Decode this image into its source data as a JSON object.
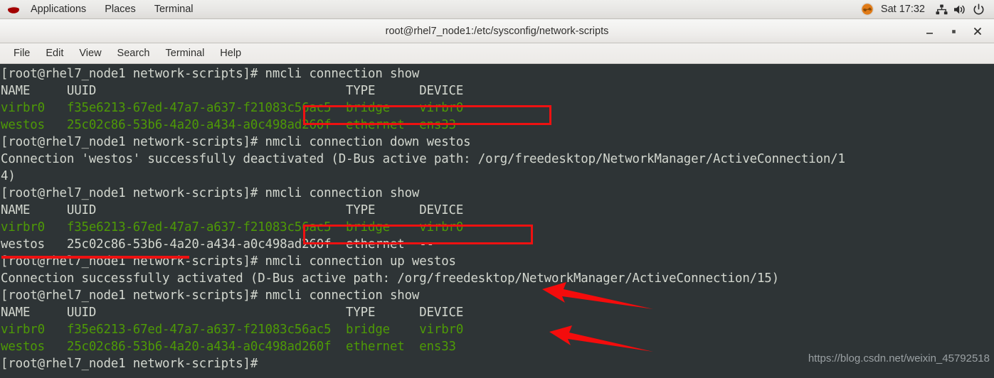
{
  "panel": {
    "logo_icon": "redhat-logo-icon",
    "menus": [
      {
        "label": "Applications",
        "name": "panel-menu-applications"
      },
      {
        "label": "Places",
        "name": "panel-menu-places"
      },
      {
        "label": "Terminal",
        "name": "panel-menu-terminal"
      }
    ],
    "tray": {
      "app_indicator_icon": "terminal-app-indicator-icon",
      "clock": "Sat 17:32",
      "network_icon": "network-icon",
      "volume_icon": "volume-icon",
      "power_icon": "power-icon"
    }
  },
  "window": {
    "title": "root@rhel7_node1:/etc/sysconfig/network-scripts",
    "buttons": {
      "minimize": "minimize-button",
      "maximize": "maximize-button",
      "close": "close-button"
    },
    "menubar": [
      {
        "label": "File",
        "name": "menu-file"
      },
      {
        "label": "Edit",
        "name": "menu-edit"
      },
      {
        "label": "View",
        "name": "menu-view"
      },
      {
        "label": "Search",
        "name": "menu-search"
      },
      {
        "label": "Terminal",
        "name": "menu-terminal"
      },
      {
        "label": "Help",
        "name": "menu-help"
      }
    ]
  },
  "terminal": {
    "prompt": "[root@rhel7_node1 network-scripts]# ",
    "colors": {
      "background": "#2e3436",
      "foreground": "#d3d7cf",
      "green": "#4e9a06",
      "bright_green": "#8ae234",
      "annotation_red": "#ee1111"
    },
    "lines": [
      {
        "id": "l1",
        "segments": [
          {
            "text": "[root@rhel7_node1 network-scripts]# nmcli connection show",
            "color": "white"
          }
        ]
      },
      {
        "id": "l2",
        "segments": [
          {
            "text": "NAME     UUID                                  TYPE      DEVICE ",
            "color": "white"
          }
        ]
      },
      {
        "id": "l3",
        "segments": [
          {
            "text": "virbr0   f35e6213-67ed-47a7-a637-f21083c56ac5  bridge    virbr0 ",
            "color": "green"
          }
        ]
      },
      {
        "id": "l4",
        "segments": [
          {
            "text": "westos   25c02c86-53b6-4a20-a434-a0c498ad260f  ethernet  ens33  ",
            "color": "green"
          }
        ]
      },
      {
        "id": "l5",
        "segments": [
          {
            "text": "[root@rhel7_node1 network-scripts]# nmcli connection down westos",
            "color": "white"
          }
        ]
      },
      {
        "id": "l6",
        "segments": [
          {
            "text": "Connection 'westos' successfully deactivated (D-Bus active path: /org/freedesktop/NetworkManager/ActiveConnection/1",
            "color": "white"
          }
        ]
      },
      {
        "id": "l7",
        "segments": [
          {
            "text": "4)",
            "color": "white"
          }
        ]
      },
      {
        "id": "l8",
        "segments": [
          {
            "text": "[root@rhel7_node1 network-scripts]# nmcli connection show",
            "color": "white"
          }
        ]
      },
      {
        "id": "l9",
        "segments": [
          {
            "text": "NAME     UUID                                  TYPE      DEVICE ",
            "color": "white"
          }
        ]
      },
      {
        "id": "l10",
        "segments": [
          {
            "text": "virbr0   f35e6213-67ed-47a7-a637-f21083c56ac5  bridge    virbr0 ",
            "color": "green"
          }
        ]
      },
      {
        "id": "l11",
        "segments": [
          {
            "text": "westos   25c02c86-53b6-4a20-a434-a0c498ad260f  ethernet  --     ",
            "color": "white"
          }
        ]
      },
      {
        "id": "l12",
        "segments": [
          {
            "text": "[root@rhel7_node1 network-scripts]# nmcli connection up westos",
            "color": "white"
          }
        ]
      },
      {
        "id": "l13",
        "segments": [
          {
            "text": "Connection successfully activated (D-Bus active path: /org/freedesktop/NetworkManager/ActiveConnection/15)",
            "color": "white"
          }
        ]
      },
      {
        "id": "l14",
        "segments": [
          {
            "text": "[root@rhel7_node1 network-scripts]# nmcli connection show",
            "color": "white"
          }
        ]
      },
      {
        "id": "l15",
        "segments": [
          {
            "text": "NAME     UUID                                  TYPE      DEVICE ",
            "color": "white"
          }
        ]
      },
      {
        "id": "l16",
        "segments": [
          {
            "text": "virbr0   f35e6213-67ed-47a7-a637-f21083c56ac5  bridge    virbr0 ",
            "color": "green"
          }
        ]
      },
      {
        "id": "l17",
        "segments": [
          {
            "text": "westos   25c02c86-53b6-4a20-a434-a0c498ad260f  ethernet  ens33  ",
            "color": "green"
          }
        ]
      },
      {
        "id": "l18",
        "segments": [
          {
            "text": "[root@rhel7_node1 network-scripts]# ",
            "color": "white"
          }
        ]
      }
    ]
  },
  "annotations": {
    "box_down_command": {
      "label": "nmcli connection down westos"
    },
    "box_up_command": {
      "label": "nmcli connection up westos"
    },
    "underline_activated": {
      "label": "Connection successfully activated"
    },
    "arrow_virbr0_middle": {
      "label": "points at virbr0 row"
    },
    "arrow_westos_final": {
      "label": "points at westos ens33 row"
    }
  },
  "watermark": {
    "text": "https://blog.csdn.net/weixin_45792518"
  }
}
